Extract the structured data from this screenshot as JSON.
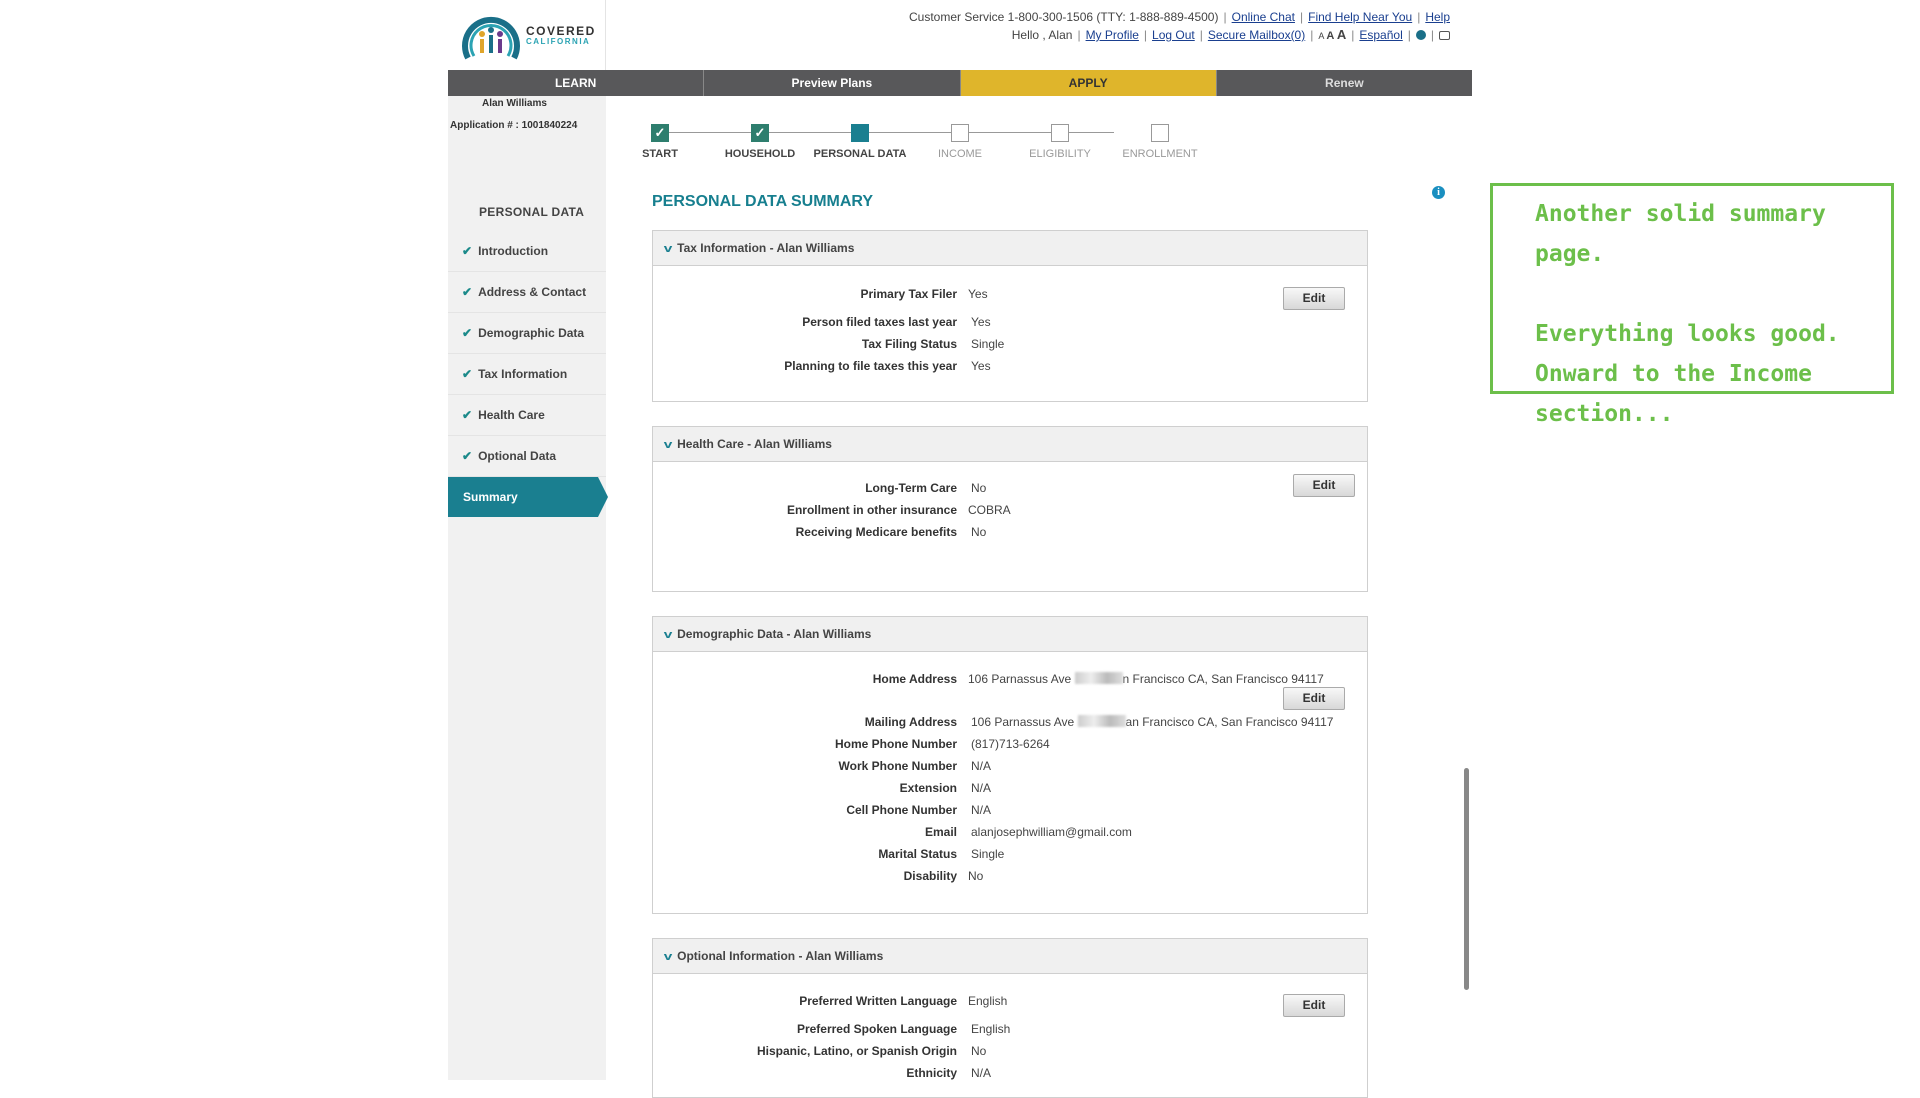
{
  "header": {
    "logo_word1": "COVERED",
    "logo_word2": "CALIFORNIA",
    "customer_service": "Customer Service 1-800-300-1506 (TTY: 1-888-889-4500)",
    "online_chat": "Online Chat",
    "find_help": "Find Help Near You",
    "help": "Help",
    "greeting": "Hello , Alan",
    "my_profile": "My Profile",
    "log_out": "Log Out",
    "mailbox": "Secure Mailbox(0)",
    "font_small": "A",
    "font_medium": "A",
    "font_large": "A",
    "espanol": "Español"
  },
  "nav": [
    "LEARN",
    "Preview Plans",
    "APPLY",
    "Renew"
  ],
  "sidebar": {
    "user_name": "Alan Williams",
    "application_no": "Application # : 1001840224",
    "heading": "PERSONAL DATA",
    "items": [
      {
        "label": "Introduction"
      },
      {
        "label": "Address & Contact"
      },
      {
        "label": "Demographic Data"
      },
      {
        "label": "Tax Information"
      },
      {
        "label": "Health Care"
      },
      {
        "label": "Optional Data"
      },
      {
        "label": "Summary"
      }
    ]
  },
  "progress": {
    "steps": [
      "START",
      "HOUSEHOLD",
      "PERSONAL DATA",
      "INCOME",
      "ELIGIBILITY",
      "ENROLLMENT"
    ],
    "check": "✓"
  },
  "page_title": "PERSONAL DATA SUMMARY",
  "edit_label": "Edit",
  "sections": {
    "tax": {
      "title": "Tax Information - Alan Williams",
      "rows": [
        {
          "label": "Primary Tax Filer",
          "value": "Yes"
        },
        {
          "label": "Person filed taxes last year",
          "value": "Yes"
        },
        {
          "label": "Tax Filing Status",
          "value": "Single"
        },
        {
          "label": "Planning to file taxes this year",
          "value": "Yes"
        }
      ]
    },
    "health": {
      "title": "Health Care - Alan Williams",
      "rows": [
        {
          "label": "Long-Term Care",
          "value": "No"
        },
        {
          "label": "Enrollment in other insurance",
          "value": "COBRA"
        },
        {
          "label": "Receiving Medicare benefits",
          "value": "No"
        }
      ]
    },
    "demo": {
      "title": "Demographic Data - Alan Williams",
      "home_address_pre": "106 Parnassus Ave",
      "home_address_post": "n Francisco CA, San Francisco 94117",
      "mailing_address_pre": "106 Parnassus Ave",
      "mailing_address_post": "an Francisco CA, San Francisco 94117",
      "rows": [
        {
          "label": "Home Address",
          "value": ""
        },
        {
          "label": "Mailing Address",
          "value": ""
        },
        {
          "label": "Home Phone Number",
          "value": "(817)713-6264"
        },
        {
          "label": "Work Phone Number",
          "value": "N/A"
        },
        {
          "label": "Extension",
          "value": "N/A"
        },
        {
          "label": "Cell Phone Number",
          "value": "N/A"
        },
        {
          "label": "Email",
          "value": "alanjosephwilliam@gmail.com"
        },
        {
          "label": "Marital Status",
          "value": "Single"
        },
        {
          "label": "Disability",
          "value": "No"
        }
      ]
    },
    "optional": {
      "title": "Optional Information - Alan Williams",
      "rows": [
        {
          "label": "Preferred Written Language",
          "value": "English"
        },
        {
          "label": "Preferred Spoken Language",
          "value": "English"
        },
        {
          "label": "Hispanic, Latino, or Spanish Origin",
          "value": "No"
        },
        {
          "label": "Ethnicity",
          "value": "N/A"
        }
      ]
    }
  },
  "note": {
    "line1": "Another solid summary page.",
    "line2": "Everything looks good.",
    "line3": "Onward to the Income",
    "line4": "section..."
  },
  "colors": {
    "teal": "#1a7f90",
    "apply_gold": "#dfb52b",
    "nav_gray": "#58585a",
    "note_green": "#6cbf4a"
  }
}
